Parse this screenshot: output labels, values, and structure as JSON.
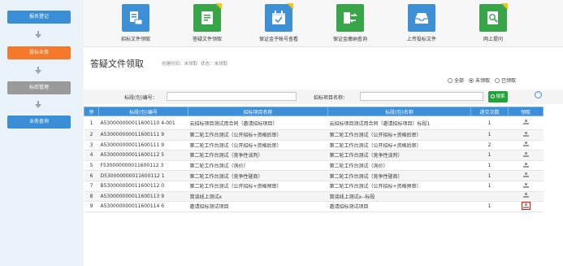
{
  "sidebar": {
    "items": [
      {
        "label": "报名登记"
      },
      {
        "label": "投标业务"
      },
      {
        "label": "标后管理"
      },
      {
        "label": "业务查询"
      }
    ]
  },
  "toolbar": {
    "items": [
      {
        "label": "招标文件领取",
        "icon": "tender-document-icon"
      },
      {
        "label": "答疑文件领取",
        "icon": "qa-document-icon"
      },
      {
        "label": "保证金子帐号查看",
        "icon": "deposit-calendar-icon"
      },
      {
        "label": "保证金缴纳查询",
        "icon": "deposit-transfer-icon"
      },
      {
        "label": "上传投标文件",
        "icon": "upload-inbox-icon"
      },
      {
        "label": "网上提问",
        "icon": "online-question-icon"
      }
    ]
  },
  "page": {
    "title": "答疑文件领取",
    "meta_created": "创建时间：未领取",
    "meta_status": "状态：未领取"
  },
  "filters": {
    "options": [
      "全部",
      "未领取",
      "已领取"
    ],
    "selected": "未领取"
  },
  "search": {
    "section_code_label": "标段(包)编号：",
    "section_code_value": "",
    "project_name_label": "招标项目名称：",
    "project_name_value": "",
    "button_label": "搜索"
  },
  "table": {
    "headers": [
      "序",
      "标段(包)编号",
      "招标项目名称",
      "标段(包)名称",
      "递交次数",
      "领取"
    ],
    "rows": [
      {
        "no": "1",
        "code": "A530000000011600110 4-001",
        "project": "云招标项目测试用合同（邀请招标项目）",
        "section": "云招标项目测试用合同（邀请招标项目）标段1",
        "count": "1"
      },
      {
        "no": "2",
        "code": "A530000000011600111 9",
        "project": "第二轮工作台测试（公开招标+资格后审）",
        "section": "第二轮工作台测试（公开招标+资格后审）",
        "count": "1"
      },
      {
        "no": "3",
        "code": "A530000000011600111 9",
        "project": "第二轮工作台测试（公开招标+资格后审）",
        "section": "第二轮工作台测试（公开招标+资格后审）",
        "count": "2"
      },
      {
        "no": "4",
        "code": "A530000000011600112 5",
        "project": "第二轮工作台测试（竞争性谈判）",
        "section": "第二轮工作台测试（竞争性谈判）",
        "count": "1"
      },
      {
        "no": "5",
        "code": "F530000000011600112 3",
        "project": "第二轮工作台测试（询价）",
        "section": "第二轮工作台测试（询价）",
        "count": "1"
      },
      {
        "no": "6",
        "code": "D530000000011600112 1",
        "project": "第二轮工作台测试（竞争性磋商）",
        "section": "第二轮工作台测试（竞争性磋商）",
        "count": "1"
      },
      {
        "no": "7",
        "code": "B530000000011600112 0",
        "project": "第二轮工作台测试（公开招标+资格预审）",
        "section": "第二轮工作台测试（公开招标+资格预审）",
        "count": "1"
      },
      {
        "no": "8",
        "code": "A530000000011600113 9",
        "project": "賞谈线上测试x",
        "section": "賞谈线上测试x--标段",
        "count": ""
      },
      {
        "no": "9",
        "code": "A530000000011600114 6",
        "project": "邀请招标测试项目",
        "section": "邀请招标测试项目",
        "count": "1"
      }
    ]
  },
  "colors": {
    "primary": "#3a8fd8",
    "active": "#f5792a",
    "search": "#22a43a",
    "highlight": "#e11111"
  }
}
